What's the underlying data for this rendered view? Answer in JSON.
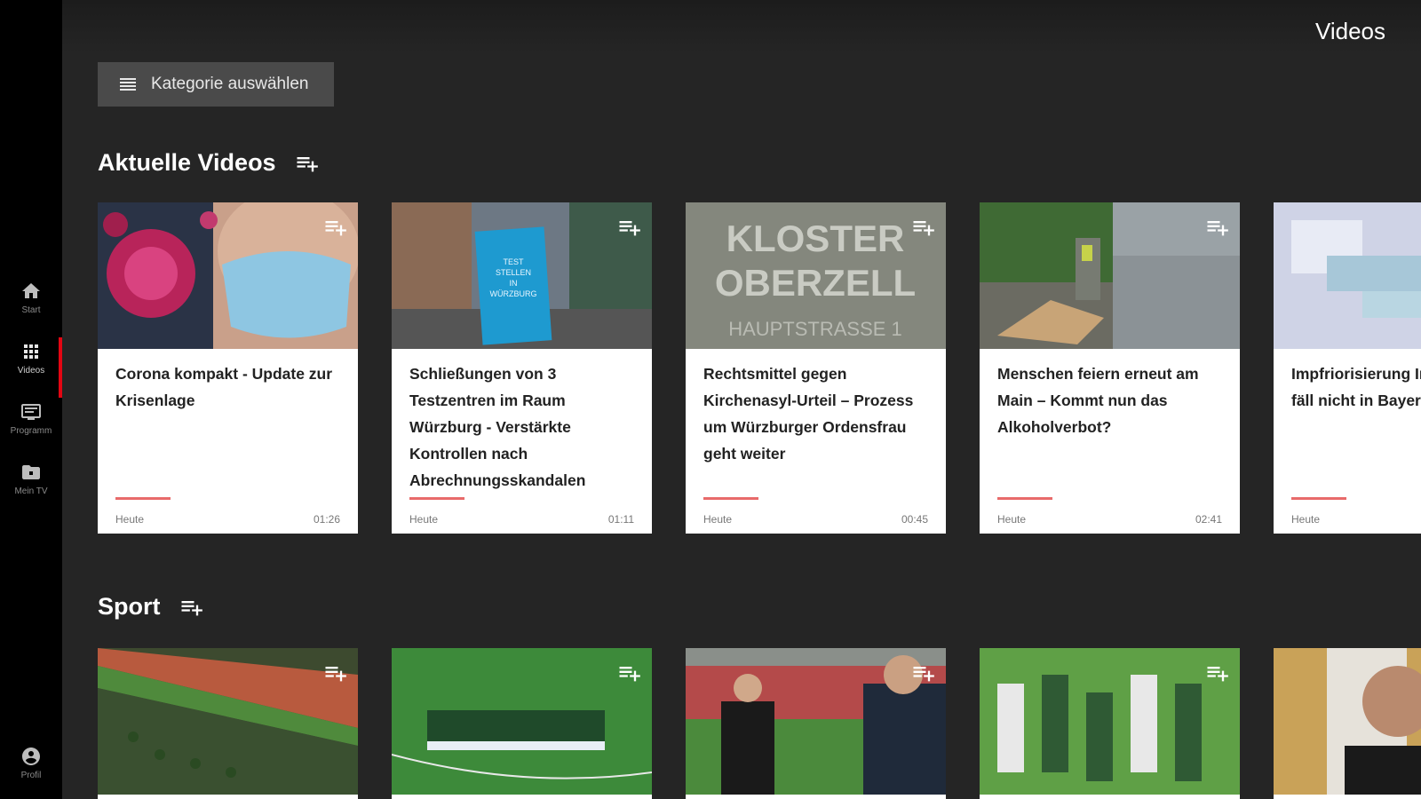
{
  "app": {
    "page_title": "Videos"
  },
  "sidebar": {
    "items": [
      {
        "label": "Start",
        "icon": "home-icon"
      },
      {
        "label": "Videos",
        "icon": "grid-icon",
        "active": true
      },
      {
        "label": "Programm",
        "icon": "tv-icon"
      },
      {
        "label": "Mein TV",
        "icon": "folder-icon"
      },
      {
        "label": "Profil",
        "icon": "profile-icon"
      }
    ],
    "accent_color": "#e30613"
  },
  "category_button": {
    "label": "Kategorie auswählen",
    "icon": "list-icon"
  },
  "sections": [
    {
      "title": "Aktuelle Videos",
      "cards": [
        {
          "title": "Corona kompakt - Update zur Krisenlage",
          "date": "Heute",
          "duration": "01:26"
        },
        {
          "title": "Schließungen von 3 Testzentren im Raum Würzburg - Verstärkte Kontrollen nach Abrechnungsskandalen",
          "date": "Heute",
          "duration": "01:11"
        },
        {
          "title": "Rechtsmittel gegen Kirchenasyl-Urteil – Prozess um Würzburger Ordensfrau geht weiter",
          "date": "Heute",
          "duration": "00:45"
        },
        {
          "title": "Menschen feiern erneut am Main – Kommt nun das Alkoholverbot?",
          "date": "Heute",
          "duration": "02:41"
        },
        {
          "title": "Impfriorisierung Impfzentren fäll nicht in Bayern",
          "date": "Heute",
          "duration": ""
        }
      ]
    },
    {
      "title": "Sport",
      "cards": [
        {},
        {},
        {},
        {},
        {}
      ]
    }
  ],
  "thumb_texts": {
    "kloster": "KLOSTER OBERZELL",
    "hauptstrasse": "HAUPTSTRASSE 1",
    "testzentrum": "TEST STELLEN IN WÜRZBURG"
  }
}
